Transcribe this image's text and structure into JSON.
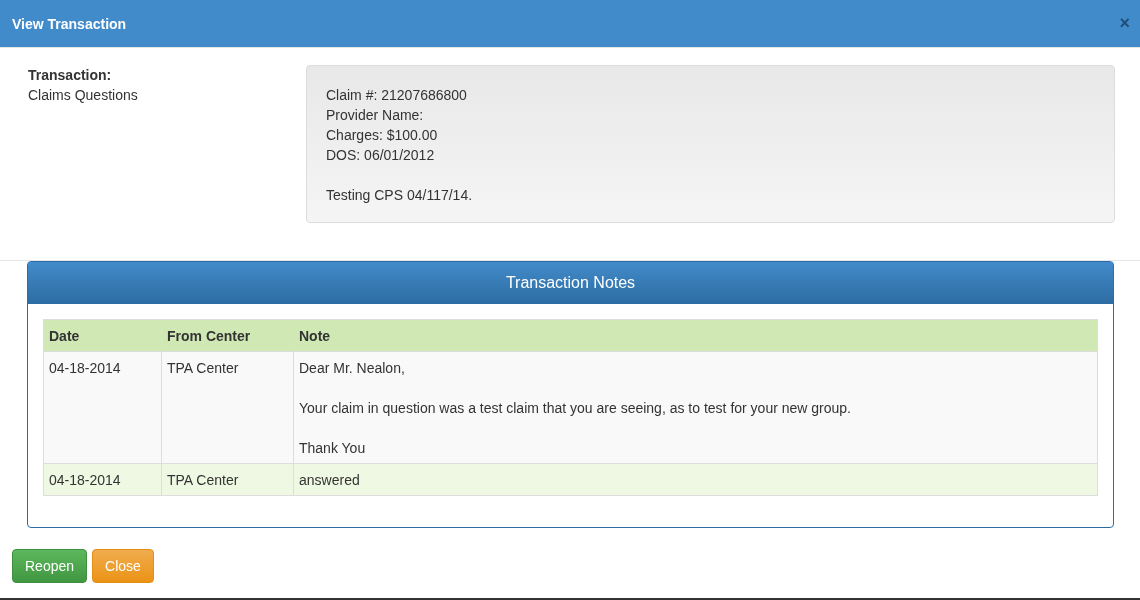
{
  "dialog": {
    "title": "View Transaction",
    "close_glyph": "×"
  },
  "transaction": {
    "label": "Transaction:",
    "value": "Claims Questions"
  },
  "details": {
    "lines": [
      "Claim #: 21207686800",
      "Provider Name:",
      "Charges: $100.00",
      "DOS: 06/01/2012"
    ],
    "remark": "Testing CPS 04/117/14."
  },
  "notes_panel": {
    "title": "Transaction Notes",
    "columns": [
      "Date",
      "From Center",
      "Note"
    ],
    "rows": [
      {
        "kind": "default",
        "date": "04-18-2014",
        "center": "TPA Center",
        "note": [
          "Dear Mr. Nealon,",
          "Your claim in question was a test claim that you are seeing, as to test for your new group.",
          "Thank You"
        ]
      },
      {
        "kind": "success",
        "date": "04-18-2014",
        "center": "TPA Center",
        "note": [
          "answered"
        ]
      }
    ]
  },
  "buttons": [
    {
      "label": "Reopen",
      "kind": "success"
    },
    {
      "label": "Close",
      "kind": "warning"
    }
  ]
}
